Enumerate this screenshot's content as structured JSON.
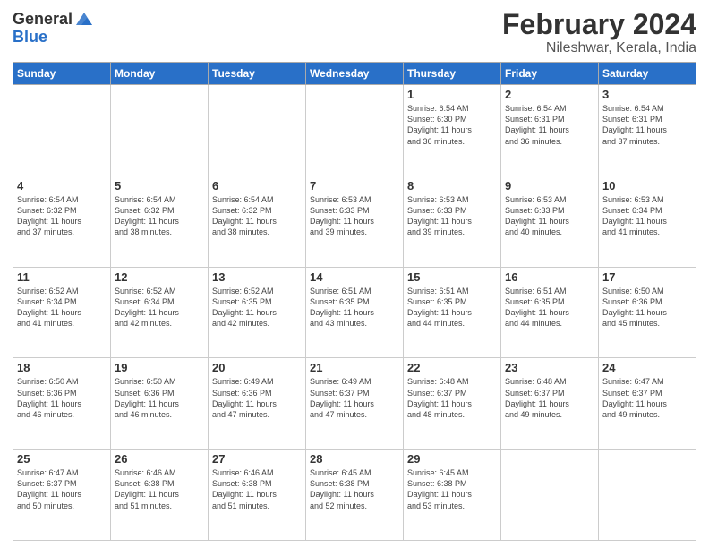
{
  "logo": {
    "general": "General",
    "blue": "Blue"
  },
  "header": {
    "title": "February 2024",
    "subtitle": "Nileshwar, Kerala, India"
  },
  "days_of_week": [
    "Sunday",
    "Monday",
    "Tuesday",
    "Wednesday",
    "Thursday",
    "Friday",
    "Saturday"
  ],
  "weeks": [
    [
      {
        "day": "",
        "info": ""
      },
      {
        "day": "",
        "info": ""
      },
      {
        "day": "",
        "info": ""
      },
      {
        "day": "",
        "info": ""
      },
      {
        "day": "1",
        "info": "Sunrise: 6:54 AM\nSunset: 6:30 PM\nDaylight: 11 hours\nand 36 minutes."
      },
      {
        "day": "2",
        "info": "Sunrise: 6:54 AM\nSunset: 6:31 PM\nDaylight: 11 hours\nand 36 minutes."
      },
      {
        "day": "3",
        "info": "Sunrise: 6:54 AM\nSunset: 6:31 PM\nDaylight: 11 hours\nand 37 minutes."
      }
    ],
    [
      {
        "day": "4",
        "info": "Sunrise: 6:54 AM\nSunset: 6:32 PM\nDaylight: 11 hours\nand 37 minutes."
      },
      {
        "day": "5",
        "info": "Sunrise: 6:54 AM\nSunset: 6:32 PM\nDaylight: 11 hours\nand 38 minutes."
      },
      {
        "day": "6",
        "info": "Sunrise: 6:54 AM\nSunset: 6:32 PM\nDaylight: 11 hours\nand 38 minutes."
      },
      {
        "day": "7",
        "info": "Sunrise: 6:53 AM\nSunset: 6:33 PM\nDaylight: 11 hours\nand 39 minutes."
      },
      {
        "day": "8",
        "info": "Sunrise: 6:53 AM\nSunset: 6:33 PM\nDaylight: 11 hours\nand 39 minutes."
      },
      {
        "day": "9",
        "info": "Sunrise: 6:53 AM\nSunset: 6:33 PM\nDaylight: 11 hours\nand 40 minutes."
      },
      {
        "day": "10",
        "info": "Sunrise: 6:53 AM\nSunset: 6:34 PM\nDaylight: 11 hours\nand 41 minutes."
      }
    ],
    [
      {
        "day": "11",
        "info": "Sunrise: 6:52 AM\nSunset: 6:34 PM\nDaylight: 11 hours\nand 41 minutes."
      },
      {
        "day": "12",
        "info": "Sunrise: 6:52 AM\nSunset: 6:34 PM\nDaylight: 11 hours\nand 42 minutes."
      },
      {
        "day": "13",
        "info": "Sunrise: 6:52 AM\nSunset: 6:35 PM\nDaylight: 11 hours\nand 42 minutes."
      },
      {
        "day": "14",
        "info": "Sunrise: 6:51 AM\nSunset: 6:35 PM\nDaylight: 11 hours\nand 43 minutes."
      },
      {
        "day": "15",
        "info": "Sunrise: 6:51 AM\nSunset: 6:35 PM\nDaylight: 11 hours\nand 44 minutes."
      },
      {
        "day": "16",
        "info": "Sunrise: 6:51 AM\nSunset: 6:35 PM\nDaylight: 11 hours\nand 44 minutes."
      },
      {
        "day": "17",
        "info": "Sunrise: 6:50 AM\nSunset: 6:36 PM\nDaylight: 11 hours\nand 45 minutes."
      }
    ],
    [
      {
        "day": "18",
        "info": "Sunrise: 6:50 AM\nSunset: 6:36 PM\nDaylight: 11 hours\nand 46 minutes."
      },
      {
        "day": "19",
        "info": "Sunrise: 6:50 AM\nSunset: 6:36 PM\nDaylight: 11 hours\nand 46 minutes."
      },
      {
        "day": "20",
        "info": "Sunrise: 6:49 AM\nSunset: 6:36 PM\nDaylight: 11 hours\nand 47 minutes."
      },
      {
        "day": "21",
        "info": "Sunrise: 6:49 AM\nSunset: 6:37 PM\nDaylight: 11 hours\nand 47 minutes."
      },
      {
        "day": "22",
        "info": "Sunrise: 6:48 AM\nSunset: 6:37 PM\nDaylight: 11 hours\nand 48 minutes."
      },
      {
        "day": "23",
        "info": "Sunrise: 6:48 AM\nSunset: 6:37 PM\nDaylight: 11 hours\nand 49 minutes."
      },
      {
        "day": "24",
        "info": "Sunrise: 6:47 AM\nSunset: 6:37 PM\nDaylight: 11 hours\nand 49 minutes."
      }
    ],
    [
      {
        "day": "25",
        "info": "Sunrise: 6:47 AM\nSunset: 6:37 PM\nDaylight: 11 hours\nand 50 minutes."
      },
      {
        "day": "26",
        "info": "Sunrise: 6:46 AM\nSunset: 6:38 PM\nDaylight: 11 hours\nand 51 minutes."
      },
      {
        "day": "27",
        "info": "Sunrise: 6:46 AM\nSunset: 6:38 PM\nDaylight: 11 hours\nand 51 minutes."
      },
      {
        "day": "28",
        "info": "Sunrise: 6:45 AM\nSunset: 6:38 PM\nDaylight: 11 hours\nand 52 minutes."
      },
      {
        "day": "29",
        "info": "Sunrise: 6:45 AM\nSunset: 6:38 PM\nDaylight: 11 hours\nand 53 minutes."
      },
      {
        "day": "",
        "info": ""
      },
      {
        "day": "",
        "info": ""
      }
    ]
  ]
}
